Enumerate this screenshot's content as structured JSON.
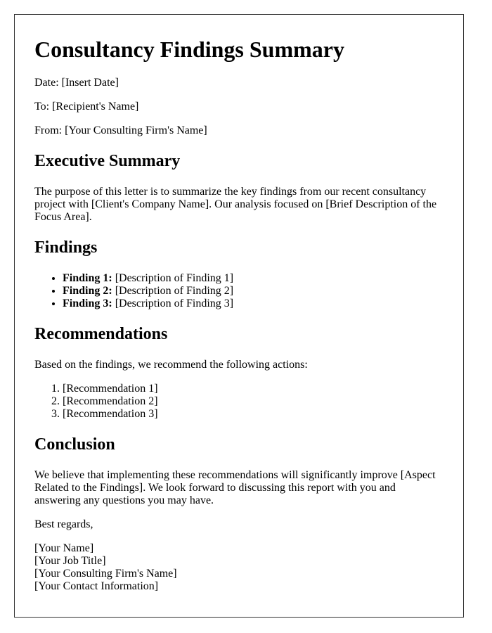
{
  "document": {
    "title": "Consultancy Findings Summary",
    "meta": {
      "date": "Date: [Insert Date]",
      "to": "To: [Recipient's Name]",
      "from": "From: [Your Consulting Firm's Name]"
    },
    "executive_summary": {
      "heading": "Executive Summary",
      "body": "The purpose of this letter is to summarize the key findings from our recent consultancy project with [Client's Company Name]. Our analysis focused on [Brief Description of the Focus Area]."
    },
    "findings": {
      "heading": "Findings",
      "items": [
        {
          "label": "Finding 1:",
          "text": " [Description of Finding 1]"
        },
        {
          "label": "Finding 2:",
          "text": " [Description of Finding 2]"
        },
        {
          "label": "Finding 3:",
          "text": " [Description of Finding 3]"
        }
      ]
    },
    "recommendations": {
      "heading": "Recommendations",
      "intro": "Based on the findings, we recommend the following actions:",
      "items": [
        "[Recommendation 1]",
        "[Recommendation 2]",
        "[Recommendation 3]"
      ]
    },
    "conclusion": {
      "heading": "Conclusion",
      "body": "We believe that implementing these recommendations will significantly improve [Aspect Related to the Findings]. We look forward to discussing this report with you and answering any questions you may have.",
      "closing": "Best regards,"
    },
    "signature": {
      "name": "[Your Name]",
      "job_title": "[Your Job Title]",
      "firm": "[Your Consulting Firm's Name]",
      "contact": "[Your Contact Information]"
    }
  }
}
